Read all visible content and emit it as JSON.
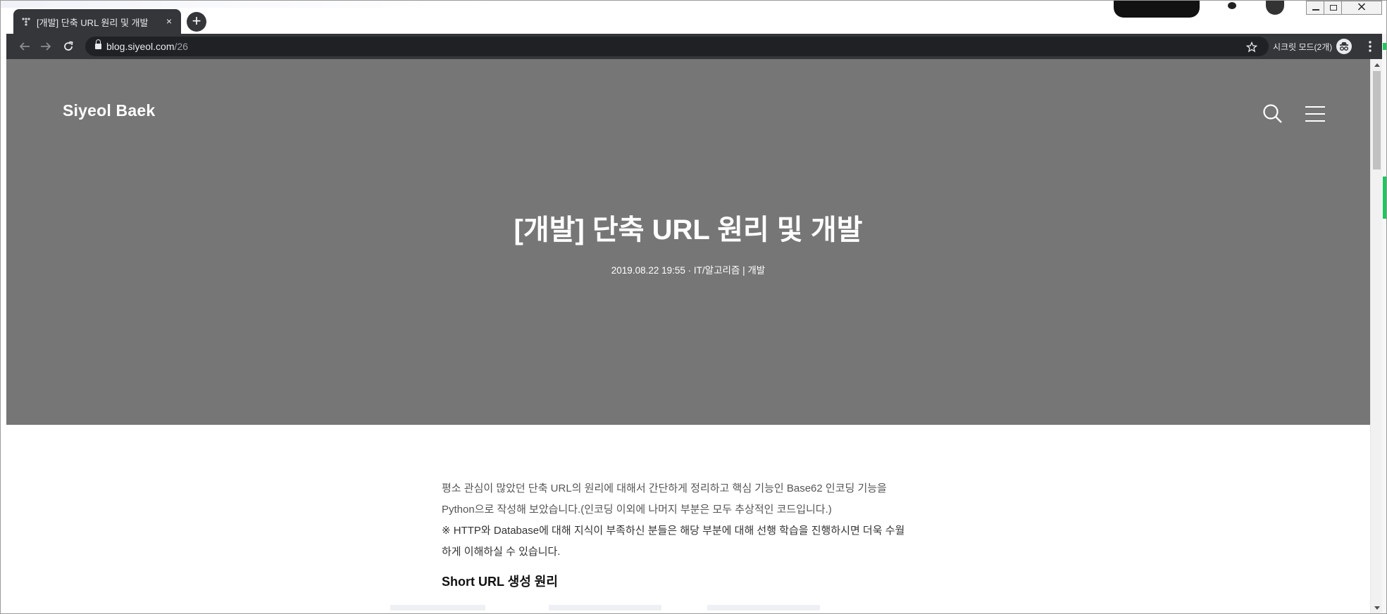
{
  "browser": {
    "tab": {
      "title": "[개발] 단축 URL 원리 및 개발",
      "favicon": "tistory-icon",
      "close_glyph": "×"
    },
    "new_tab_glyph": "+",
    "address": {
      "host": "blog.siyeol.com",
      "path": "/26"
    },
    "incognito_label": "시크릿 모드(2개)",
    "icons": {
      "back": "arrow-left-icon",
      "forward": "arrow-right-icon",
      "reload": "reload-icon",
      "lock": "lock-icon",
      "bookmark": "star-icon",
      "incognito": "incognito-icon",
      "menu": "kebab-menu-icon"
    },
    "colors": {
      "tab_bg": "#35363a",
      "omnibox_bg": "#202124",
      "text": "#e8eaed"
    }
  },
  "blog": {
    "site_title": "Siyeol Baek",
    "post": {
      "title": "[개발] 단축 URL 원리 및 개발",
      "date": "2019.08.22 19:55",
      "separator": "·",
      "category": "IT/알고리즘 | 개발"
    },
    "body": {
      "intro_line1": "평소 관심이 많았던 단축 URL의 원리에 대해서 간단하게 정리하고 핵심 기능인 Base62 인코딩 기능을",
      "intro_line2": "Python으로 작성해 보았습니다.(인코딩 이외에 나머지 부분은 모두 추상적인 코드입니다.)",
      "note_line1": "※ HTTP와 Database에 대해 지식이 부족하신 분들은 해당 부분에 대해 선행 학습을 진행하시면 더욱 수월",
      "note_line2": "하게 이해하실 수 있습니다.",
      "heading": "Short URL 생성 원리"
    },
    "colors": {
      "hero_bg": "#767676",
      "text": "#555555",
      "heading": "#111111"
    }
  }
}
